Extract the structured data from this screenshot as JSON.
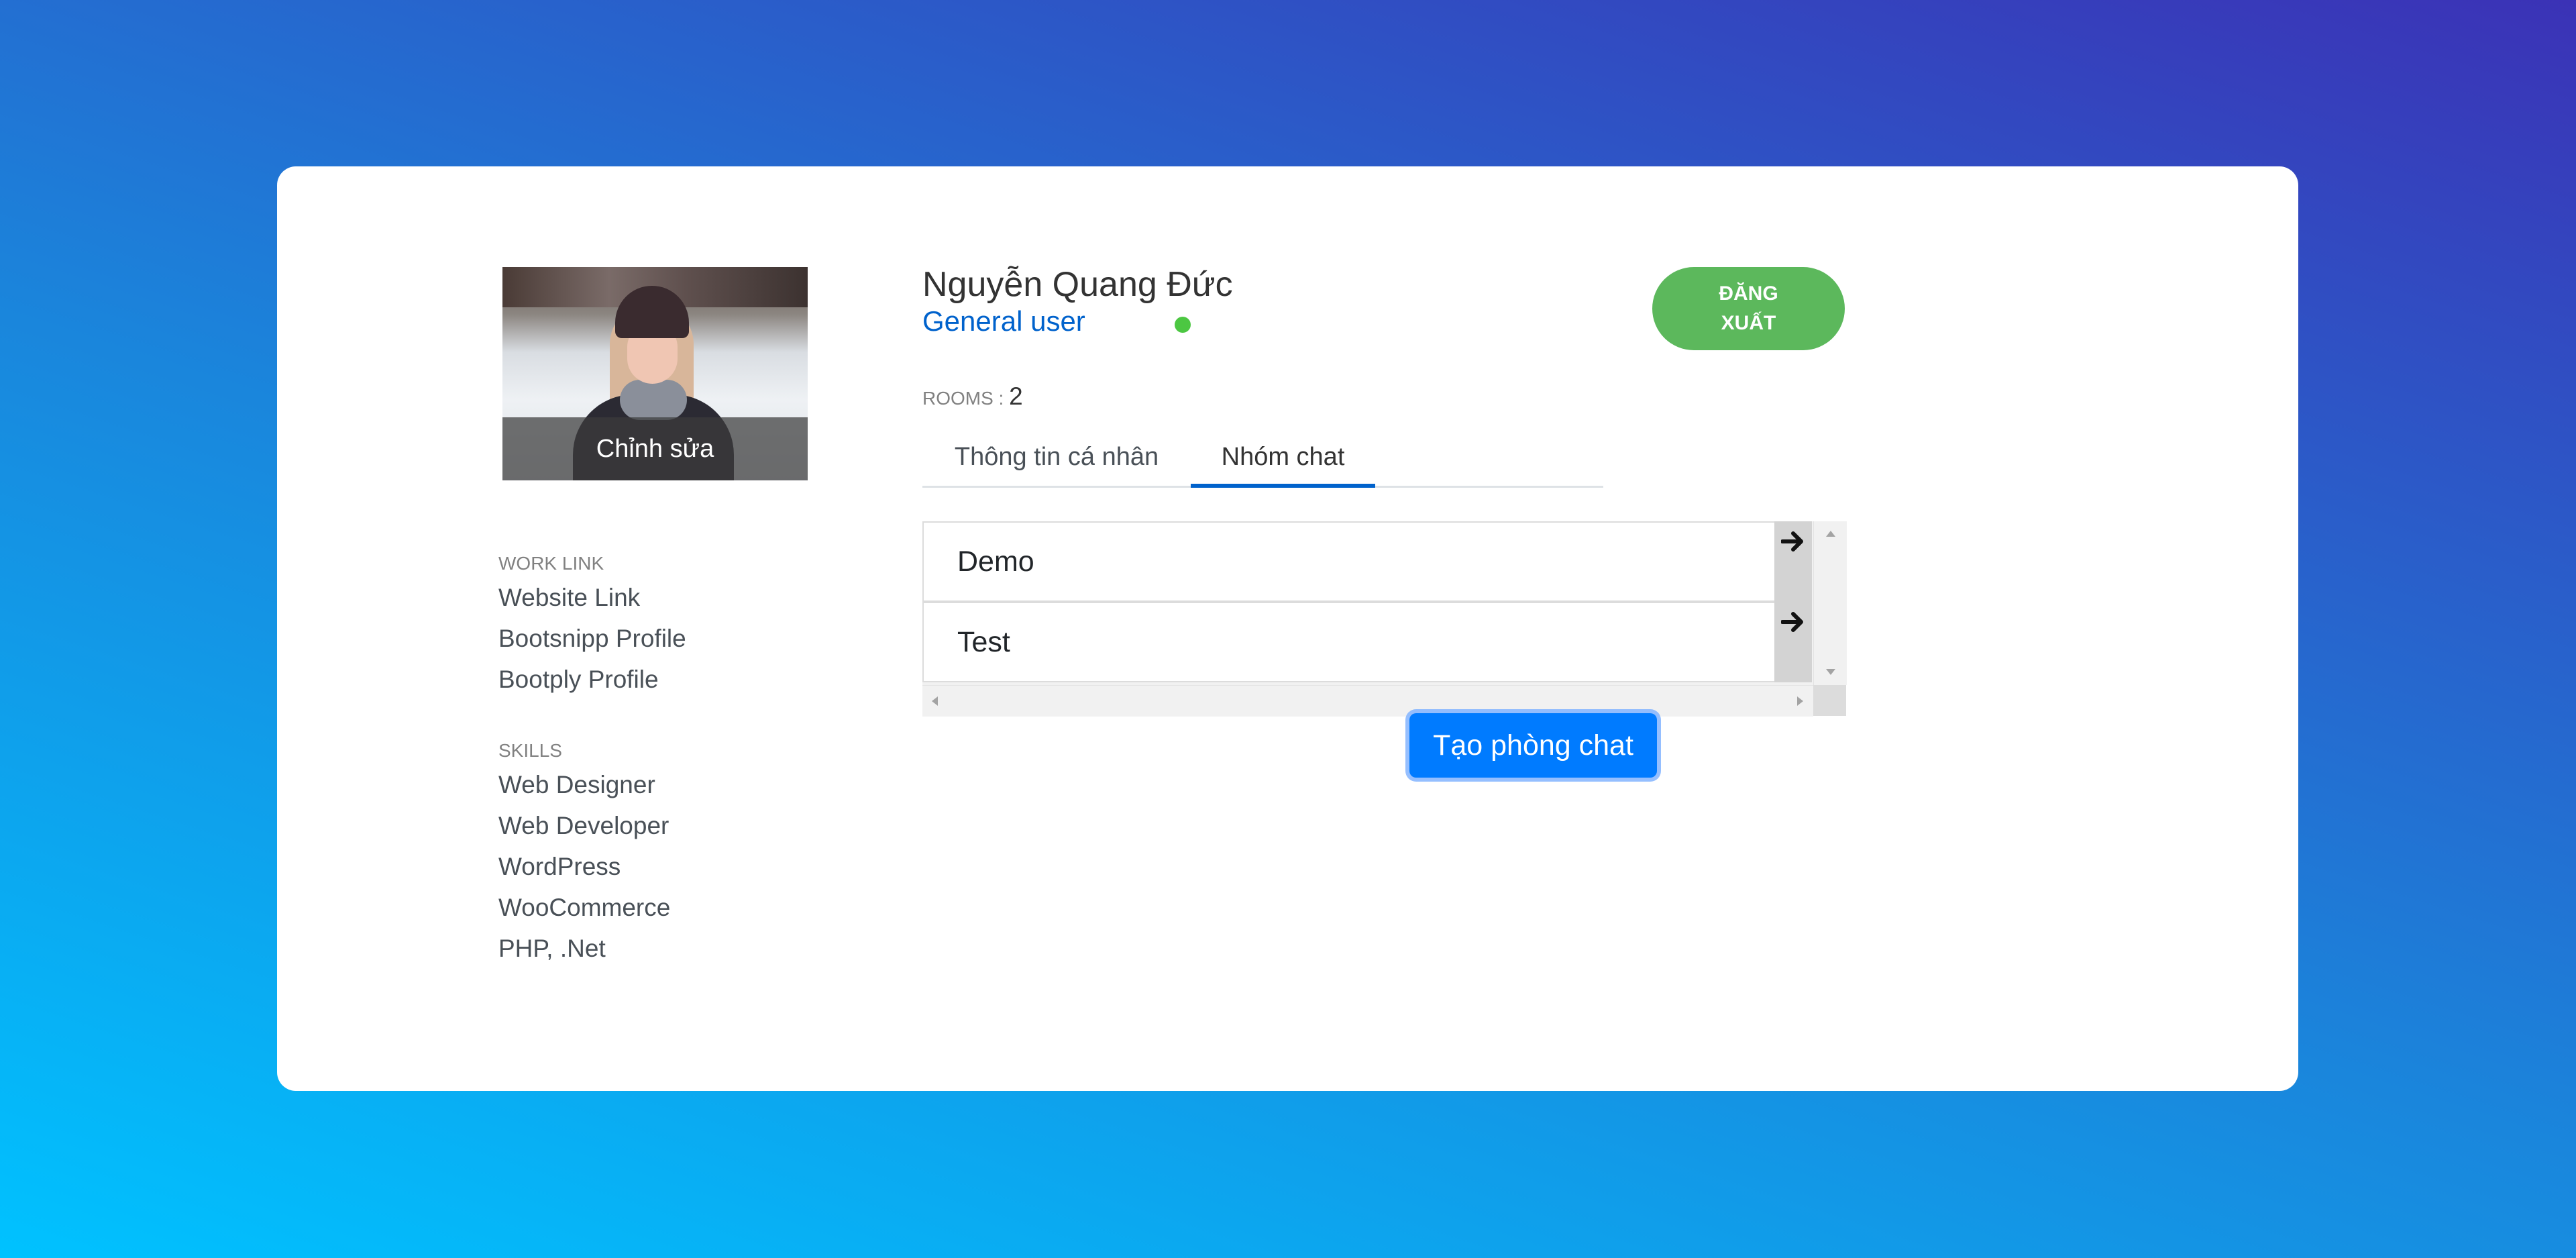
{
  "profile": {
    "edit_label": "Chỉnh sửa",
    "name": "Nguyễn Quang Đức",
    "role": "General user",
    "rooms_label": "ROOMS : ",
    "rooms_count": "2"
  },
  "logout": {
    "label_line1": "ĐĂNG",
    "label_line2": "XUẤT"
  },
  "tabs": [
    {
      "label": "Thông tin cá nhân",
      "active": false
    },
    {
      "label": "Nhóm chat",
      "active": true
    }
  ],
  "sidebar": {
    "work_link": {
      "title": "WORK LINK",
      "items": [
        "Website Link",
        "Bootsnipp Profile",
        "Bootply Profile"
      ]
    },
    "skills": {
      "title": "SKILLS",
      "items": [
        "Web Designer",
        "Web Developer",
        "WordPress",
        "WooCommerce",
        "PHP, .Net"
      ]
    }
  },
  "rooms": [
    {
      "name": "Demo",
      "icon": "arrow-right-icon"
    },
    {
      "name": "Test",
      "icon": "arrow-right-icon"
    }
  ],
  "create_room_label": "Tạo phòng chat",
  "colors": {
    "gradient_start": "#00c2ff",
    "gradient_end": "#3b32b6",
    "logout_green": "#5cb85c",
    "primary_blue": "#007bff",
    "role_blue": "#0062cc",
    "online_green": "#4cc742"
  }
}
